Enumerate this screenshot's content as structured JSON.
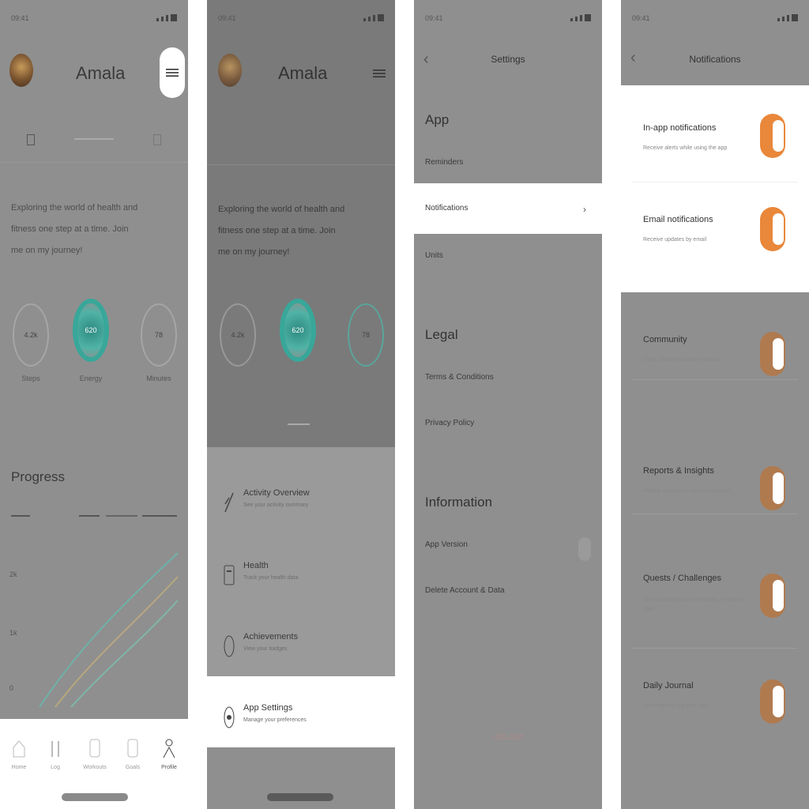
{
  "status_bar": {
    "time": "09:41"
  },
  "profile": {
    "name": "Amala",
    "bio": [
      "Exploring the world of health and",
      "fitness one step at a time. Join",
      "me on my journey!"
    ],
    "rings": [
      {
        "value": "4.2k",
        "label": "Steps"
      },
      {
        "value": "620",
        "label": "Energy"
      },
      {
        "value": "78",
        "label": "Minutes"
      }
    ],
    "section_title": "Progress",
    "chart_y_ticks": [
      "2k",
      "1k",
      "0"
    ]
  },
  "bottom_nav": {
    "items": [
      {
        "label": "Home",
        "icon": "home-icon"
      },
      {
        "label": "Log",
        "icon": "log-icon"
      },
      {
        "label": "Workouts",
        "icon": "workouts-icon"
      },
      {
        "label": "Goals",
        "icon": "goals-icon"
      },
      {
        "label": "Profile",
        "icon": "profile-icon"
      }
    ]
  },
  "menu_sheet": {
    "items": [
      {
        "title": "Activity Overview",
        "subtitle": "See your activity summary",
        "icon": "activity-icon"
      },
      {
        "title": "Health",
        "subtitle": "Track your health data",
        "icon": "health-icon"
      },
      {
        "title": "Achievements",
        "subtitle": "View your badges",
        "icon": "trophy-icon"
      }
    ],
    "highlighted": {
      "title": "App Settings",
      "subtitle": "Manage your preferences",
      "icon": "settings-icon"
    }
  },
  "settings": {
    "title": "Settings",
    "sections": [
      {
        "heading": "App",
        "rows": [
          "Reminders",
          "Notifications",
          "Units"
        ]
      },
      {
        "heading": "Legal",
        "rows": [
          "Terms & Conditions",
          "Privacy Policy"
        ]
      },
      {
        "heading": "Information",
        "rows": [
          "App Version",
          "Delete Account & Data"
        ]
      }
    ],
    "logout": "LOG OUT"
  },
  "notifications": {
    "title": "Notifications",
    "master": [
      {
        "title": "In-app notifications",
        "subtitle": "Receive alerts while using the app",
        "on": true
      },
      {
        "title": "Email notifications",
        "subtitle": "Receive updates by email",
        "on": true
      }
    ],
    "items": [
      {
        "title": "Community",
        "subtitle": "Likes, comments and mentions",
        "on": true
      },
      {
        "title": "Reports & Insights",
        "subtitle": "Weekly summaries of your progress",
        "on": true
      },
      {
        "title": "Quests / Challenges",
        "subtitle": "New challenges and reminders to stay on track",
        "on": true
      },
      {
        "title": "Daily Journal",
        "subtitle": "Reminders to log your day",
        "on": true
      }
    ]
  },
  "colors": {
    "accent": "#e9873a",
    "ring": "#38a79a",
    "dim_overlay": "#8f8f8f"
  }
}
